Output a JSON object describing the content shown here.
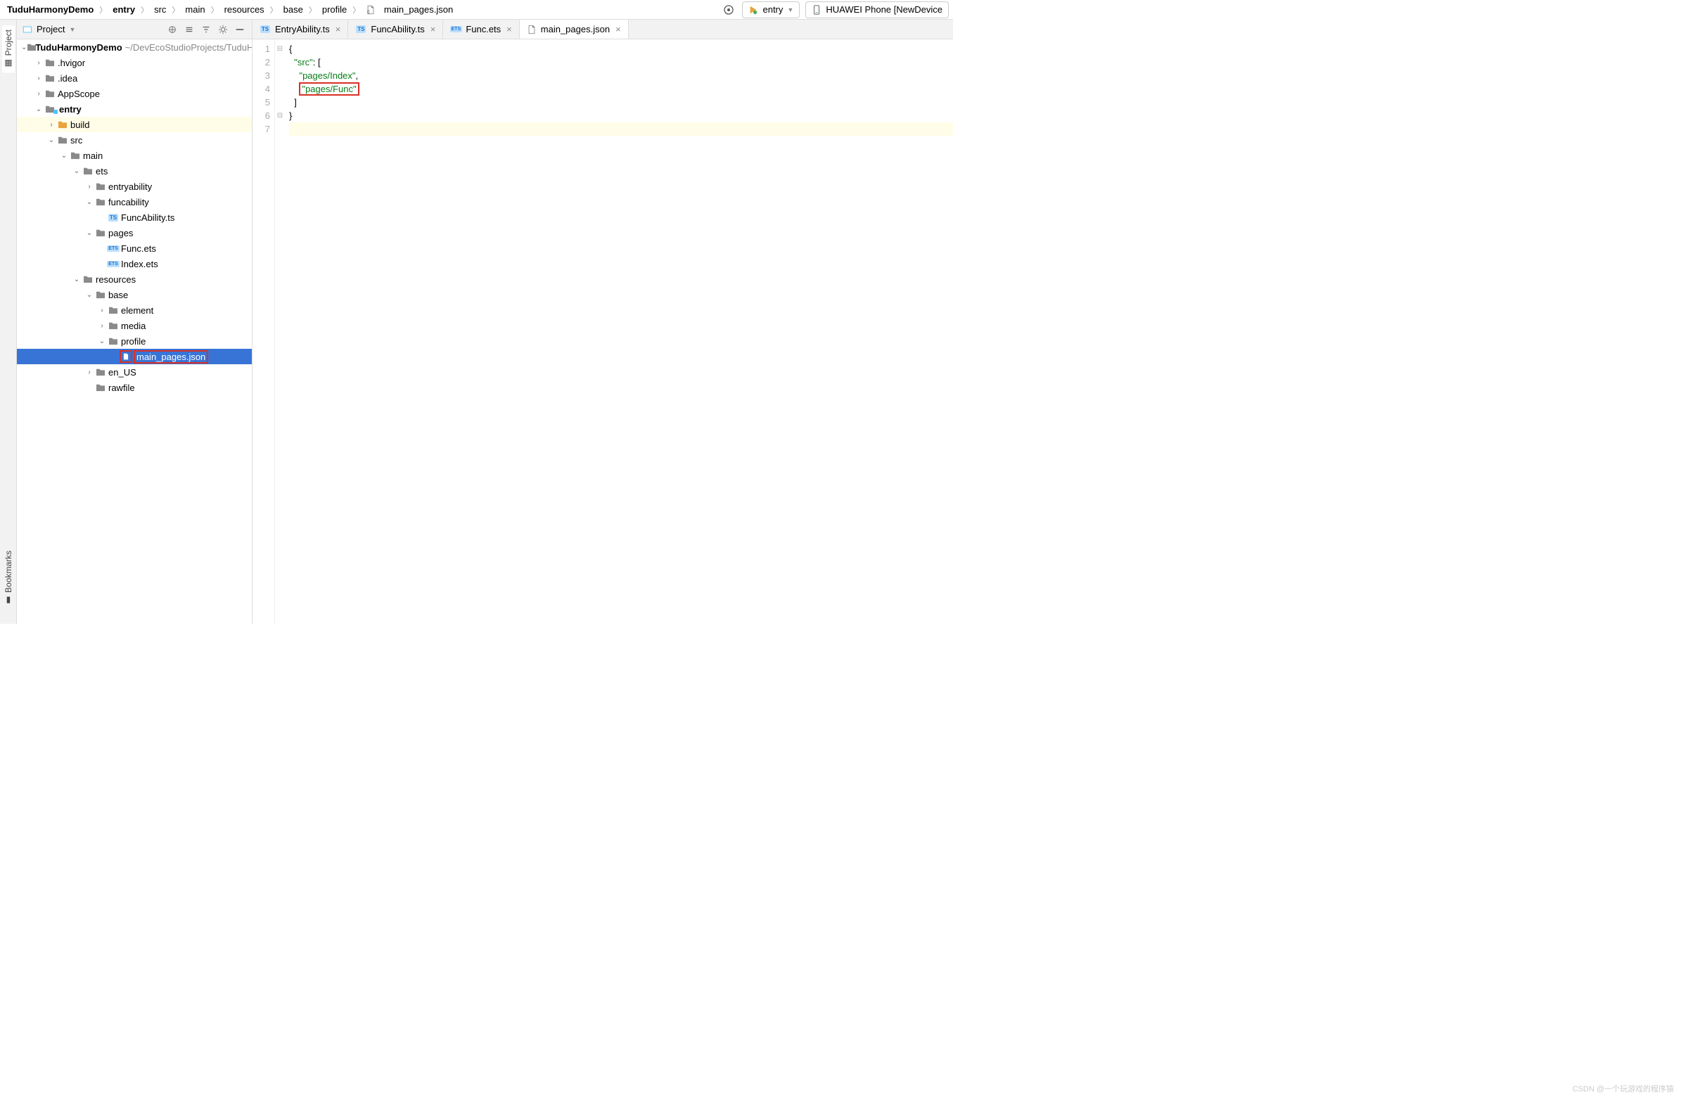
{
  "breadcrumbs": [
    "TuduHarmonyDemo",
    "entry",
    "src",
    "main",
    "resources",
    "base",
    "profile",
    "main_pages.json"
  ],
  "top": {
    "config": "entry",
    "device": "HUAWEI Phone [NewDevice"
  },
  "side": {
    "project": "Project",
    "bookmarks": "Bookmarks"
  },
  "panel": {
    "title": "Project"
  },
  "tree": {
    "root": {
      "name": "TuduHarmonyDemo",
      "path": "~/DevEcoStudioProjects/TuduHa"
    },
    "hvigor": ".hvigor",
    "idea": ".idea",
    "appscope": "AppScope",
    "entry": "entry",
    "build": "build",
    "src": "src",
    "main": "main",
    "ets": "ets",
    "entryability": "entryability",
    "funcability": "funcability",
    "funcabilityts": "FuncAbility.ts",
    "pages": "pages",
    "funcets": "Func.ets",
    "indexets": "Index.ets",
    "resources": "resources",
    "base": "base",
    "element": "element",
    "media": "media",
    "profile": "profile",
    "mainpages": "main_pages.json",
    "enus": "en_US",
    "rawfile": "rawfile"
  },
  "tabs": [
    {
      "label": "EntryAbility.ts",
      "type": "ts"
    },
    {
      "label": "FuncAbility.ts",
      "type": "ts"
    },
    {
      "label": "Func.ets",
      "type": "ets"
    },
    {
      "label": "main_pages.json",
      "type": "json",
      "active": true
    }
  ],
  "code": {
    "l1": "{",
    "l2_key": "\"src\"",
    "l2_rest": ": [",
    "l3": "\"pages/Index\"",
    "l3_comma": ",",
    "l4": "\"pages/Func\"",
    "l5": "]",
    "l6": "}"
  },
  "watermark": "CSDN @一个玩游戏的程序猿"
}
